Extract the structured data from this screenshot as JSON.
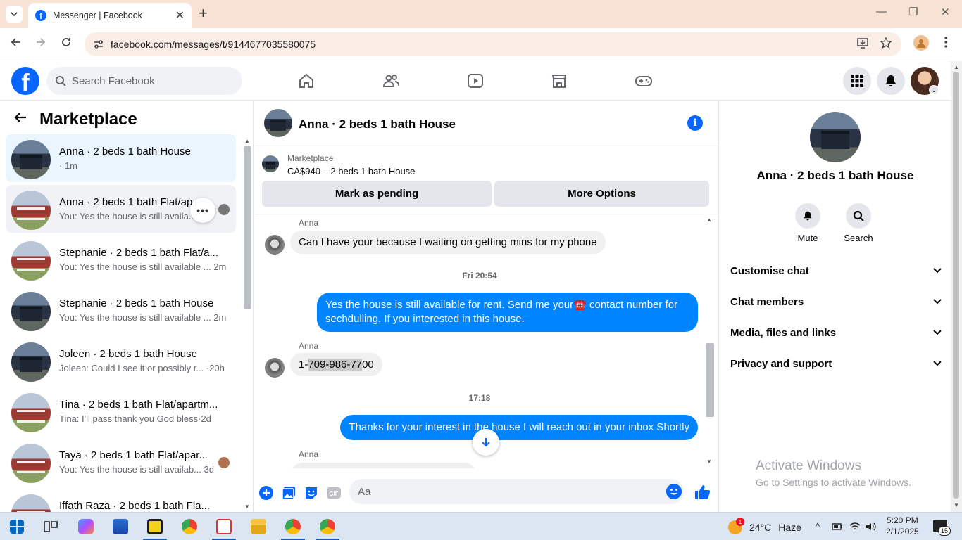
{
  "browser": {
    "tab_title": "Messenger | Facebook",
    "url": "facebook.com/messages/t/9144677035580075"
  },
  "fb": {
    "search_placeholder": "Search Facebook"
  },
  "sidebar": {
    "title": "Marketplace",
    "conversations": [
      {
        "name": "Anna · 2 beds 1 bath House",
        "preview": "· 1m",
        "image": "dark-house",
        "state": "active"
      },
      {
        "name": "Anna · 2 beds 1 bath Flat/ap...",
        "preview": "You: Yes the house is still availa...",
        "image": "red-house",
        "state": "hover"
      },
      {
        "name": "Stephanie · 2 beds 1 bath Flat/a...",
        "preview": "You: Yes the house is still available ... 2m",
        "image": "red-house"
      },
      {
        "name": "Stephanie · 2 beds 1 bath House",
        "preview": "You: Yes the house is still available ... 2m",
        "image": "dark-house"
      },
      {
        "name": "Joleen · 2 beds 1 bath House",
        "preview": "Joleen: Could I see it or possibly r... ·20h",
        "image": "dark-house"
      },
      {
        "name": "Tina · 2 beds 1 bath Flat/apartm...",
        "preview": "Tina: I'll pass thank you God bless·2d",
        "image": "red-house"
      },
      {
        "name": "Taya · 2 beds 1 bath Flat/apar...",
        "preview": "You: Yes the house is still availab... 3d",
        "image": "red-house"
      },
      {
        "name": "Iffath Raza · 2 beds 1 bath Fla...",
        "preview": "",
        "image": "red-house"
      }
    ]
  },
  "chat": {
    "header_name": "Anna · 2 beds 1 bath House",
    "banner": {
      "label": "Marketplace",
      "listing": "CA$940 – 2 beds 1 bath House",
      "btn_pending": "Mark as pending",
      "btn_more": "More Options"
    },
    "messages": {
      "sender1": "Anna",
      "msg1": "Can I have your because I waiting on getting mins for my phone",
      "ts1": "Fri 20:54",
      "out1_line1": "Yes the  house is still available for rent. Send me your☎️ contact number for",
      "out1_line2": "sechdulling. If you interested  in this house.",
      "sender2": "Anna",
      "phone_a": "1-",
      "phone_b": "709-986-77",
      "phone_c": "00",
      "ts2": "17:18",
      "out2": "Thanks for your interest in the house I will reach out  in your inbox Shortly",
      "sender3": "Anna"
    },
    "composer_placeholder": "Aa"
  },
  "details": {
    "name": "Anna · 2 beds 1 bath House",
    "mute": "Mute",
    "search": "Search",
    "sections": [
      "Customise chat",
      "Chat members",
      "Media, files and links",
      "Privacy and support"
    ]
  },
  "watermark": {
    "line1": "Activate Windows",
    "line2": "Go to Settings to activate Windows."
  },
  "taskbar": {
    "temp": "24°C",
    "weather": "Haze",
    "weather_badge": "1",
    "time": "5:20 PM",
    "date": "2/1/2025",
    "notif": "15"
  },
  "colors": {
    "fb_blue": "#0866ff",
    "messenger_blue": "#0084ff",
    "tab_bg": "#f8e3d4"
  }
}
